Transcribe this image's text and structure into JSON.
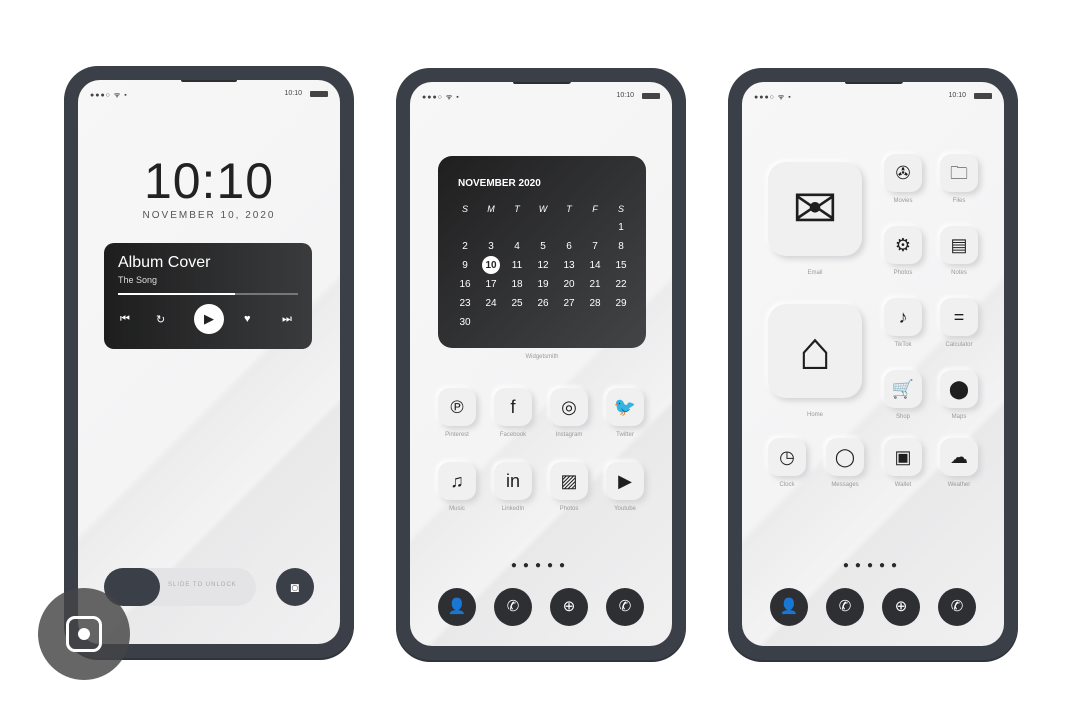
{
  "status": {
    "signal": "●●●○ ᯤ ▪",
    "time": "10:10"
  },
  "lock": {
    "clock": "10:10",
    "date": "NOVEMBER 10, 2020",
    "music": {
      "title": "Album Cover",
      "subtitle": "The Song",
      "progress": 0.65
    },
    "slider_label": "SLIDE TO UNLOCK"
  },
  "home1": {
    "calendar": {
      "month": "NOVEMBER 2020",
      "weekdays": [
        "S",
        "M",
        "T",
        "W",
        "T",
        "F",
        "S"
      ],
      "weeks": [
        [
          "",
          "",
          "",
          "",
          "",
          "",
          "1"
        ],
        [
          "2",
          "3",
          "4",
          "5",
          "6",
          "7",
          "8"
        ],
        [
          "9",
          "10",
          "11",
          "12",
          "13",
          "14",
          "15"
        ],
        [
          "16",
          "17",
          "18",
          "19",
          "20",
          "21",
          "22"
        ],
        [
          "23",
          "24",
          "25",
          "26",
          "27",
          "28",
          "29"
        ],
        [
          "30",
          "",
          "",
          "",
          "",
          "",
          ""
        ]
      ],
      "today": "10",
      "caption": "Widgetsmith"
    },
    "apps": [
      {
        "label": "Pinterest",
        "icon": "pinterest-icon",
        "glyph": "℗"
      },
      {
        "label": "Facebook",
        "icon": "facebook-icon",
        "glyph": "f"
      },
      {
        "label": "Instagram",
        "icon": "instagram-icon",
        "glyph": "◎"
      },
      {
        "label": "Twitter",
        "icon": "twitter-icon",
        "glyph": "🐦"
      },
      {
        "label": "Music",
        "icon": "music-icon",
        "glyph": "♫"
      },
      {
        "label": "LinkedIn",
        "icon": "linkedin-icon",
        "glyph": "in"
      },
      {
        "label": "Photos",
        "icon": "photos-icon",
        "glyph": "▨"
      },
      {
        "label": "Youtube",
        "icon": "youtube-icon",
        "glyph": "▶"
      }
    ]
  },
  "home2": {
    "big_apps": [
      {
        "label": "Email",
        "icon": "mail-icon",
        "glyph": "✉"
      },
      {
        "label": "Home",
        "icon": "home-icon",
        "glyph": "⌂"
      }
    ],
    "apps": [
      {
        "label": "Movies",
        "icon": "film-reel-icon",
        "glyph": "✇"
      },
      {
        "label": "Files",
        "icon": "folder-icon",
        "glyph": "🗀"
      },
      {
        "label": "Photos",
        "icon": "gear-icon",
        "glyph": "⚙"
      },
      {
        "label": "Notes",
        "icon": "notes-icon",
        "glyph": "▤"
      },
      {
        "label": "TikTok",
        "icon": "tiktok-icon",
        "glyph": "♪"
      },
      {
        "label": "Calculator",
        "icon": "calculator-icon",
        "glyph": "="
      },
      {
        "label": "Shop",
        "icon": "cart-icon",
        "glyph": "🛒"
      },
      {
        "label": "Maps",
        "icon": "location-pin-icon",
        "glyph": "⬤"
      },
      {
        "label": "Clock",
        "icon": "clock-icon",
        "glyph": "◷"
      },
      {
        "label": "Messages",
        "icon": "chat-bubble-icon",
        "glyph": "◯"
      },
      {
        "label": "Wallet",
        "icon": "wallet-icon",
        "glyph": "▣"
      },
      {
        "label": "Weather",
        "icon": "weather-icon",
        "glyph": "☁"
      }
    ]
  },
  "dock": [
    {
      "icon": "contacts-icon",
      "glyph": "👤"
    },
    {
      "icon": "whatsapp-icon",
      "glyph": "✆"
    },
    {
      "icon": "globe-icon",
      "glyph": "⊕"
    },
    {
      "icon": "phone-icon",
      "glyph": "✆"
    }
  ],
  "page_dots": "●●●●●"
}
